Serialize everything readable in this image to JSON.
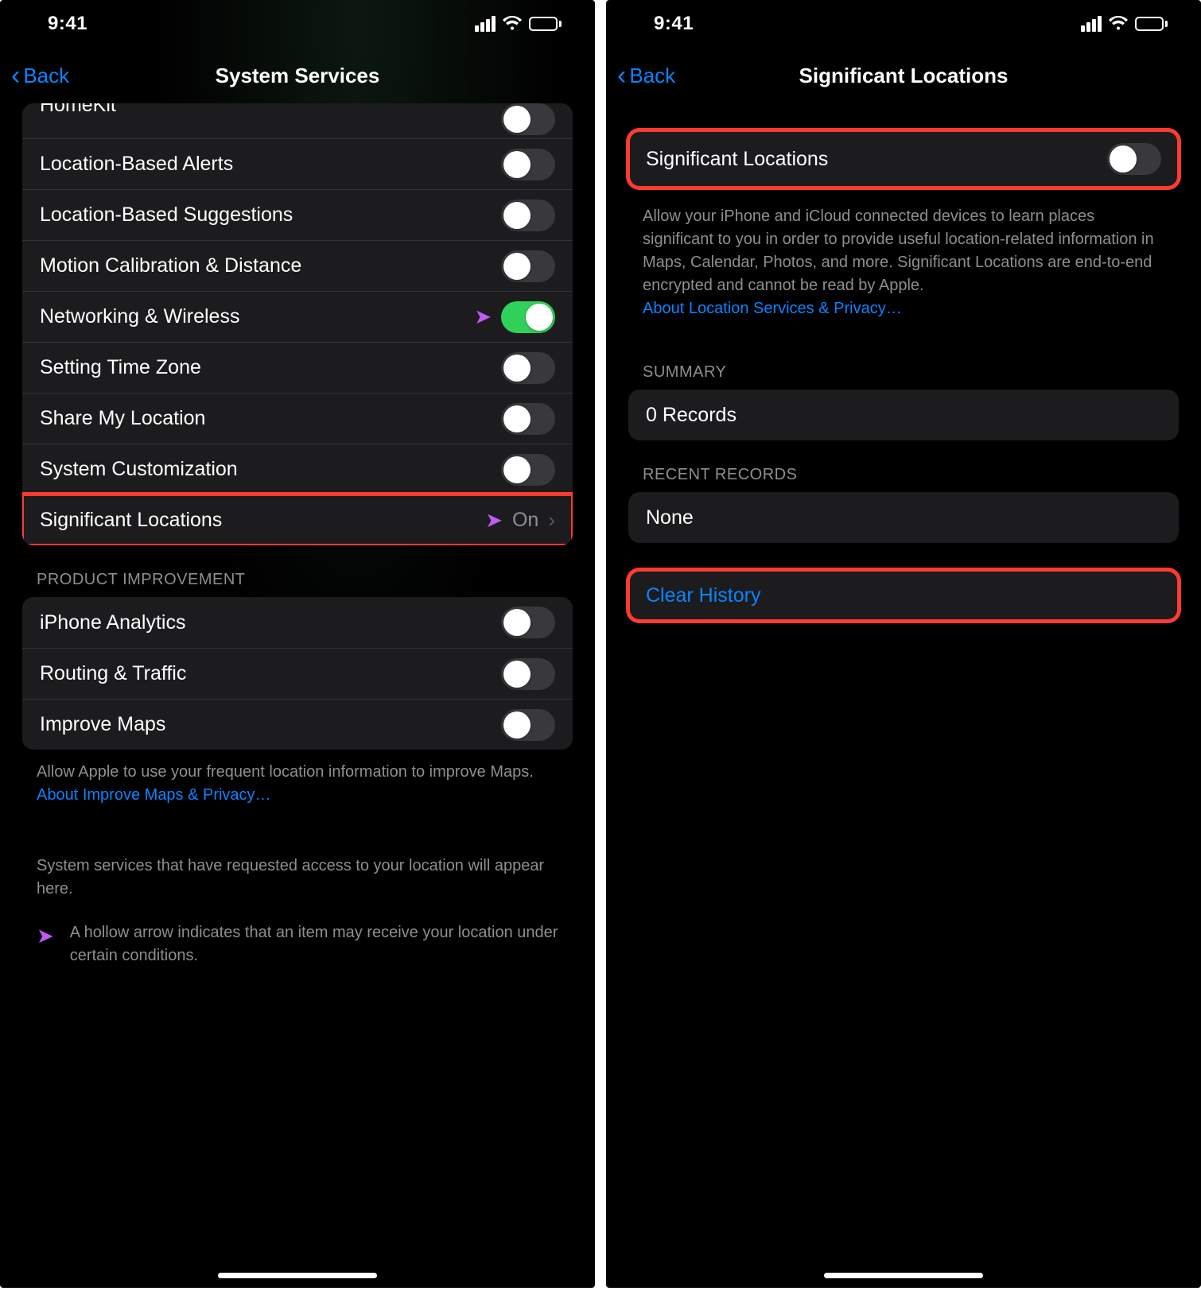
{
  "status": {
    "time": "9:41"
  },
  "left": {
    "back": "Back",
    "title": "System Services",
    "rows": [
      {
        "label": "HomeKit",
        "type": "toggle",
        "on": false,
        "partial": true
      },
      {
        "label": "Location-Based Alerts",
        "type": "toggle",
        "on": false
      },
      {
        "label": "Location-Based Suggestions",
        "type": "toggle",
        "on": false
      },
      {
        "label": "Motion Calibration & Distance",
        "type": "toggle",
        "on": false
      },
      {
        "label": "Networking & Wireless",
        "type": "toggle",
        "on": true,
        "arrow": true
      },
      {
        "label": "Setting Time Zone",
        "type": "toggle",
        "on": false
      },
      {
        "label": "Share My Location",
        "type": "toggle",
        "on": false
      },
      {
        "label": "System Customization",
        "type": "toggle",
        "on": false
      },
      {
        "label": "Significant Locations",
        "type": "nav",
        "value": "On",
        "arrow": true,
        "highlight": true
      }
    ],
    "section2_header": "PRODUCT IMPROVEMENT",
    "section2": [
      {
        "label": "iPhone Analytics",
        "on": false
      },
      {
        "label": "Routing & Traffic",
        "on": false
      },
      {
        "label": "Improve Maps",
        "on": false
      }
    ],
    "maps_note": "Allow Apple to use your frequent location information to improve Maps. ",
    "maps_link": "About Improve Maps & Privacy…",
    "sys_note": "System services that have requested access to your location will appear here.",
    "legend": "A hollow arrow indicates that an item may receive your location under certain conditions."
  },
  "right": {
    "back": "Back",
    "title": "Significant Locations",
    "toggle_label": "Significant Locations",
    "toggle_on": false,
    "desc": "Allow your iPhone and iCloud connected devices to learn places significant to you in order to provide useful location-related information in Maps, Calendar, Photos, and more. Significant Locations are end-to-end encrypted and cannot be read by Apple.",
    "desc_link": "About Location Services & Privacy…",
    "summary_header": "SUMMARY",
    "summary_value": "0 Records",
    "recent_header": "RECENT RECORDS",
    "recent_value": "None",
    "clear": "Clear History"
  }
}
